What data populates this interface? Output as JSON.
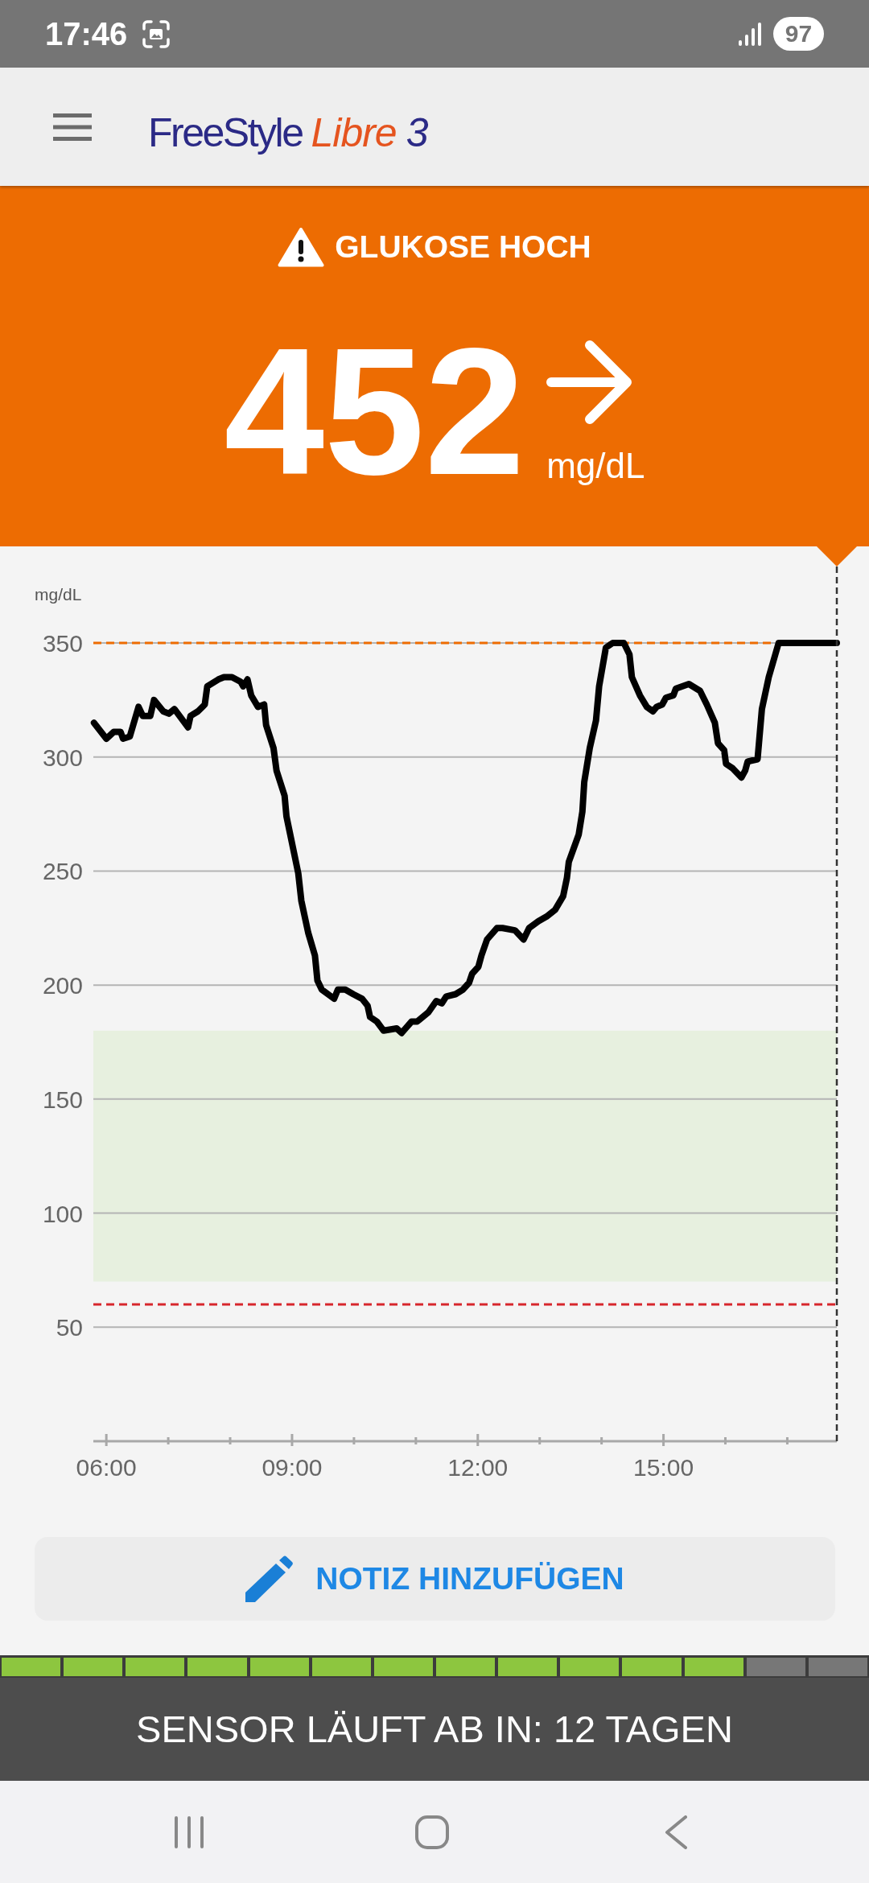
{
  "status_bar": {
    "time": "17:46",
    "battery": "97"
  },
  "header": {
    "logo": {
      "brand": "FreeStyle",
      "product": "Libre",
      "version": "3"
    }
  },
  "reading": {
    "alert": "GLUKOSE HOCH",
    "value": "452",
    "unit": "mg/dL"
  },
  "chart": {
    "chart_data": {
      "type": "line",
      "ylabel": "mg/dL",
      "x": [
        5.8,
        6.0,
        6.12,
        6.23,
        6.27,
        6.38,
        6.52,
        6.59,
        6.71,
        6.77,
        6.92,
        7.01,
        7.1,
        7.32,
        7.36,
        7.48,
        7.59,
        7.63,
        7.81,
        7.9,
        8.03,
        8.17,
        8.21,
        8.28,
        8.34,
        8.45,
        8.55,
        8.58,
        8.7,
        8.75,
        8.88,
        8.91,
        9.1,
        9.15,
        9.26,
        9.37,
        9.41,
        9.48,
        9.68,
        9.74,
        9.86,
        9.99,
        10.13,
        10.22,
        10.26,
        10.37,
        10.48,
        10.69,
        10.77,
        10.93,
        11.02,
        11.2,
        11.33,
        11.42,
        11.49,
        11.64,
        11.76,
        11.86,
        11.91,
        12.01,
        12.06,
        12.15,
        12.31,
        12.4,
        12.6,
        12.74,
        12.83,
        12.98,
        13.11,
        13.25,
        13.38,
        13.44,
        13.47,
        13.63,
        13.69,
        13.72,
        13.81,
        13.91,
        13.96,
        14.07,
        14.18,
        14.36,
        14.45,
        14.49,
        14.62,
        14.73,
        14.83,
        14.89,
        14.98,
        15.04,
        15.16,
        15.2,
        15.41,
        15.59,
        15.7,
        15.83,
        15.88,
        15.98,
        16.01,
        16.12,
        16.26,
        16.32,
        16.36,
        16.52,
        16.59,
        16.7,
        16.86,
        17.8
      ],
      "values": [
        315,
        308,
        311,
        311,
        308,
        309,
        322,
        318,
        318,
        325,
        320,
        319,
        321,
        313,
        318,
        320,
        323,
        331,
        334,
        335,
        335,
        333,
        331,
        334,
        327,
        322,
        323,
        314,
        304,
        294,
        283,
        274,
        249,
        237,
        223,
        213,
        202,
        198,
        194,
        198,
        198,
        196,
        194,
        191,
        186,
        184,
        180,
        181,
        179,
        184,
        184,
        188,
        193,
        192,
        195,
        196,
        198,
        201,
        205,
        208,
        213,
        220,
        225,
        225,
        224,
        220,
        225,
        228,
        230,
        233,
        239,
        247,
        254,
        266,
        276,
        289,
        304,
        316,
        331,
        348,
        350,
        350,
        345,
        335,
        327,
        322,
        320,
        322,
        323,
        326,
        327,
        330,
        332,
        329,
        323,
        315,
        306,
        303,
        297,
        295,
        291,
        294,
        298,
        299,
        321,
        335,
        350,
        350
      ],
      "xlim": [
        5.79,
        17.8
      ],
      "ylim": [
        0,
        350
      ],
      "xticks": [
        {
          "value": 6,
          "label": "06:00"
        },
        {
          "value": 9,
          "label": "09:00"
        },
        {
          "value": 12,
          "label": "12:00"
        },
        {
          "value": 15,
          "label": "15:00"
        }
      ],
      "yticks": [
        50,
        100,
        150,
        200,
        250,
        300,
        350
      ],
      "grid": true,
      "ref_lines": [
        {
          "axis": "y",
          "value": 350,
          "color": "#ed6c02"
        },
        {
          "axis": "y",
          "value": 60,
          "color": "#d7262c"
        }
      ],
      "bands": [
        {
          "axis": "y",
          "from": 70,
          "to": 180,
          "color": "#e7f0df"
        }
      ]
    }
  },
  "note_button": {
    "label": "NOTIZ HINZUFÜGEN"
  },
  "sensor": {
    "segments": [
      {
        "filled": true
      },
      {
        "filled": true
      },
      {
        "filled": true
      },
      {
        "filled": true
      },
      {
        "filled": true
      },
      {
        "filled": true
      },
      {
        "filled": true
      },
      {
        "filled": true
      },
      {
        "filled": true
      },
      {
        "filled": true
      },
      {
        "filled": true
      },
      {
        "filled": true
      },
      {
        "filled": false
      },
      {
        "filled": false
      }
    ],
    "expiry": "SENSOR LÄUFT AB IN: 12 TAGEN"
  }
}
